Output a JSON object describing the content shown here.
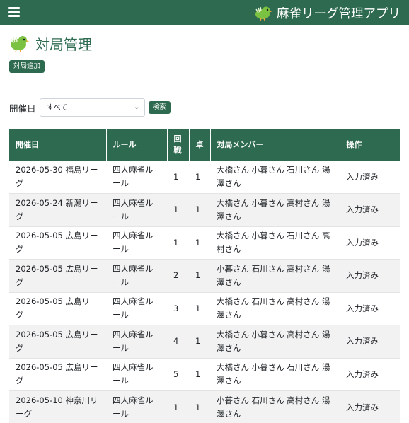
{
  "navbar": {
    "brand_title": "麻雀リーグ管理アプリ",
    "menu_icon": "hamburger-icon",
    "brand_icon": "bird-mascot-icon"
  },
  "page": {
    "title": "対局管理",
    "title_icon": "bird-mascot-icon",
    "add_button_label": "対局追加"
  },
  "filter": {
    "label": "開催日",
    "selected": "すべて",
    "search_button_label": "検索"
  },
  "table": {
    "headers": {
      "date": "開催日",
      "rule": "ルール",
      "round": "回戦",
      "table_no": "卓",
      "members": "対局メンバー",
      "action": "操作"
    },
    "rows": [
      {
        "date": "2026-05-30 福島リーグ",
        "rule": "四人麻雀ルール",
        "round": "1",
        "table_no": "1",
        "members": "大橋さん 小暮さん 石川さん 湯澤さん",
        "action": "入力済み"
      },
      {
        "date": "2026-05-24 新潟リーグ",
        "rule": "四人麻雀ルール",
        "round": "1",
        "table_no": "1",
        "members": "大橋さん 小暮さん 高村さん 湯澤さん",
        "action": "入力済み"
      },
      {
        "date": "2026-05-05 広島リーグ",
        "rule": "四人麻雀ルール",
        "round": "1",
        "table_no": "1",
        "members": "大橋さん 小暮さん 石川さん 高村さん",
        "action": "入力済み"
      },
      {
        "date": "2026-05-05 広島リーグ",
        "rule": "四人麻雀ルール",
        "round": "2",
        "table_no": "1",
        "members": "小暮さん 石川さん 高村さん 湯澤さん",
        "action": "入力済み"
      },
      {
        "date": "2026-05-05 広島リーグ",
        "rule": "四人麻雀ルール",
        "round": "3",
        "table_no": "1",
        "members": "大橋さん 石川さん 高村さん 湯澤さん",
        "action": "入力済み"
      },
      {
        "date": "2026-05-05 広島リーグ",
        "rule": "四人麻雀ルール",
        "round": "4",
        "table_no": "1",
        "members": "大橋さん 小暮さん 高村さん 湯澤さん",
        "action": "入力済み"
      },
      {
        "date": "2026-05-05 広島リーグ",
        "rule": "四人麻雀ルール",
        "round": "5",
        "table_no": "1",
        "members": "大橋さん 小暮さん 石川さん 湯澤さん",
        "action": "入力済み"
      },
      {
        "date": "2026-05-10 神奈川リーグ",
        "rule": "四人麻雀ルール",
        "round": "1",
        "table_no": "1",
        "members": "小暮さん 石川さん 高村さん 湯澤さん",
        "action": "入力済み"
      }
    ]
  },
  "colors": {
    "primary": "#2d6a4f",
    "header_text": "#ffffff",
    "row_stripe": "#f2f2f2"
  }
}
